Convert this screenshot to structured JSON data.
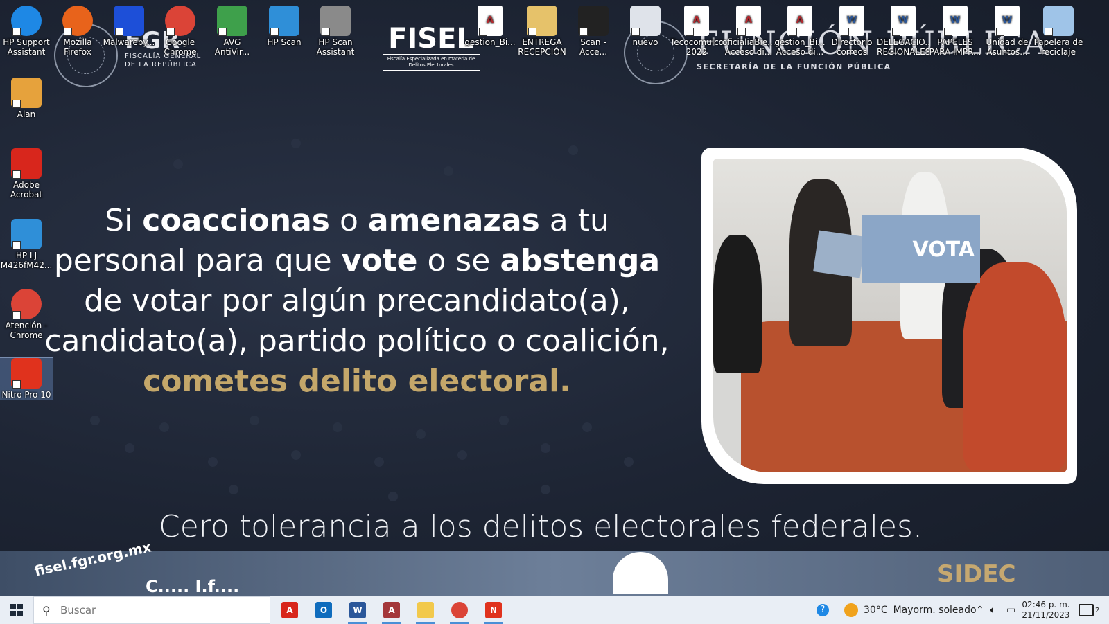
{
  "wallpaper": {
    "fgr": {
      "big": "FGR",
      "small_1": "FISCALÍA GENERAL",
      "small_2": "DE LA REPÚBLICA"
    },
    "fisel": {
      "big": "FISEL",
      "small": "Fiscalía Especializada en materia de Delitos Electorales"
    },
    "sfp": {
      "big": "FUNCIÓN PÚBLICA",
      "small": "SECRETARÍA DE LA FUNCIÓN PÚBLICA"
    },
    "headline": {
      "l1_a": "Si ",
      "l1_b": "coaccionas",
      "l1_c": " o ",
      "l1_d": "amenazas",
      "l1_e": " a tu",
      "l2_a": "personal para que ",
      "l2_b": "vote",
      "l2_c": " o se ",
      "l2_d": "abstenga",
      "l3": "de votar por algún precandidato(a),",
      "l4": "candidato(a), partido político o coalición,",
      "l5": "cometes delito electoral."
    },
    "photo_sign": "VOTA",
    "slogan": "Cero tolerancia a los delitos electorales federales.",
    "band": {
      "web": "fisel.fgr.org.mx",
      "sidec": "SIDEC"
    },
    "accent_gold": "#c4a76a"
  },
  "desktop_icons": [
    {
      "label": "HP Support\nAssistant",
      "icon": "help-icon",
      "color": "#1e88e5"
    },
    {
      "label": "Mozilla\nFirefox",
      "icon": "firefox-icon",
      "color": "#e8631b"
    },
    {
      "label": "Malwareby...",
      "icon": "malwarebytes-icon",
      "color": "#1d4fd8"
    },
    {
      "label": "Google\nChrome",
      "icon": "chrome-icon",
      "color": "#db4437"
    },
    {
      "label": "AVG\nAntiVir...",
      "icon": "avg-icon",
      "color": "#3ea04b"
    },
    {
      "label": "HP Scan",
      "icon": "scanner-icon",
      "color": "#2f8fd8"
    },
    {
      "label": "HP Scan\nAssistant",
      "icon": "scanner-assistant-icon",
      "color": "#8a8a8a"
    },
    {
      "label": "gestion_Bi...",
      "icon": "access-file-icon",
      "color": "#b5282e"
    },
    {
      "label": "ENTREGA\nRECEPCIÓN",
      "icon": "folder-zip-icon",
      "color": "#e6c26a"
    },
    {
      "label": "Scan -\nAcce...",
      "icon": "vader-icon",
      "color": "#222222"
    },
    {
      "label": "nuevo",
      "icon": "storm-trooper-icon",
      "color": "#dfe3ea"
    },
    {
      "label": "Tecocomulco\n2022",
      "icon": "pdf-file-icon",
      "color": "#b5282e"
    },
    {
      "label": "oficialiaBie...\nAcceso di...",
      "icon": "access-file-icon",
      "color": "#b5282e"
    },
    {
      "label": "gestion_Bi...\nAcceso di...",
      "icon": "access-file-icon",
      "color": "#b5282e"
    },
    {
      "label": "Directorio\ncorreos",
      "icon": "word-file-icon",
      "color": "#2b579a"
    },
    {
      "label": "DELEGACIO...\nREGIONALES",
      "icon": "word-file-icon",
      "color": "#2b579a"
    },
    {
      "label": "PAPELES\nPARA IMPR...",
      "icon": "word-file-icon",
      "color": "#2b579a"
    },
    {
      "label": "Unidad de\nAsuntos...",
      "icon": "word-file-icon",
      "color": "#2b579a"
    },
    {
      "label": "Papelera de\nreciclaje",
      "icon": "recycle-bin-icon",
      "color": "#9fc4e8"
    }
  ],
  "desktop_icons_left": [
    {
      "label": "Alan",
      "icon": "zip-folder-icon",
      "color": "#e6a23c"
    },
    {
      "label": "Adobe\nAcrobat",
      "icon": "acrobat-icon",
      "color": "#d8261c"
    },
    {
      "label": "HP LJ\nM426fM42...",
      "icon": "printer-scan-icon",
      "color": "#2f8fd8"
    },
    {
      "label": "Atención -\nChrome",
      "icon": "chrome-icon",
      "color": "#db4437"
    },
    {
      "label": "Nitro Pro 10",
      "icon": "nitro-icon",
      "color": "#e0321d"
    }
  ],
  "taskbar": {
    "search_placeholder": "Buscar",
    "apps": [
      {
        "name": "acrobat",
        "icon": "acrobat-icon",
        "color": "#d8261c",
        "glyph": "A"
      },
      {
        "name": "outlook",
        "icon": "outlook-icon",
        "color": "#0f6cbd",
        "glyph": "O"
      },
      {
        "name": "word",
        "icon": "word-icon",
        "color": "#2b579a",
        "glyph": "W"
      },
      {
        "name": "access",
        "icon": "access-icon",
        "color": "#a4373a",
        "glyph": "A"
      },
      {
        "name": "explorer",
        "icon": "folder-icon",
        "color": "#f2c94c",
        "glyph": ""
      },
      {
        "name": "chrome",
        "icon": "chrome-icon",
        "color": "#db4437",
        "glyph": ""
      },
      {
        "name": "nitro",
        "icon": "nitro-icon",
        "color": "#e0321d",
        "glyph": "N"
      }
    ],
    "weather_temp": "30°C",
    "weather_desc": "Mayorm. soleado",
    "time": "02:46 p. m.",
    "date": "21/11/2023",
    "notification_count": "2"
  }
}
